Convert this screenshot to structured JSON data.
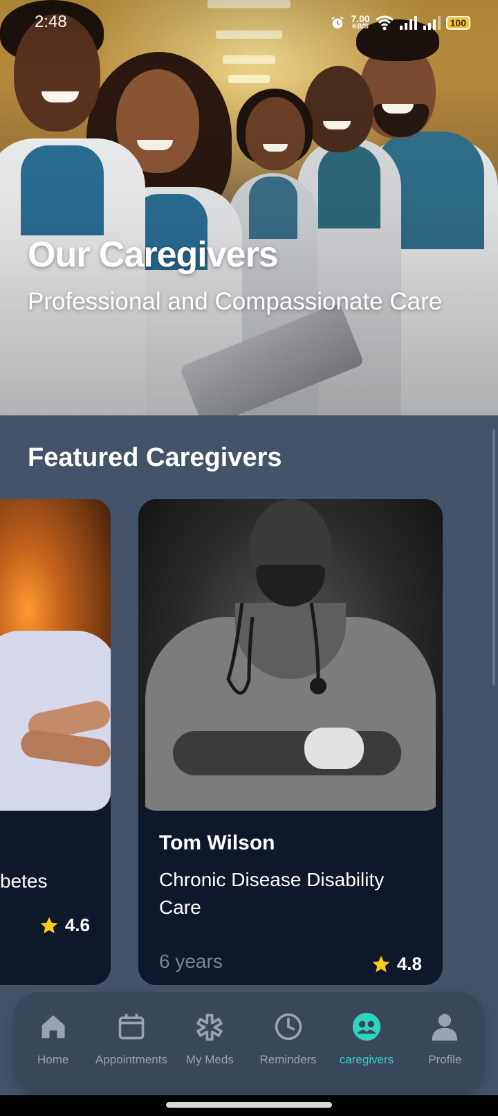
{
  "status_bar": {
    "time": "2:48",
    "net_speed": "7.00",
    "net_unit": "KB/S",
    "battery": "100"
  },
  "hero": {
    "title": "Our Caregivers",
    "subtitle": "Professional and Compassionate Care"
  },
  "featured": {
    "title": "Featured Caregivers",
    "cards": [
      {
        "name": "",
        "specialty": "betes",
        "experience": "",
        "rating": "4.6"
      },
      {
        "name": "Tom Wilson",
        "specialty": "Chronic Disease Disability Care",
        "experience": "6 years",
        "rating": "4.8"
      }
    ]
  },
  "nav": {
    "items": [
      {
        "label": "Home",
        "icon": "home-icon"
      },
      {
        "label": "Appointments",
        "icon": "calendar-icon"
      },
      {
        "label": "My Meds",
        "icon": "medical-asterisk-icon"
      },
      {
        "label": "Reminders",
        "icon": "clock-icon"
      },
      {
        "label": "caregivers",
        "icon": "caregivers-icon",
        "active": true
      },
      {
        "label": "Profile",
        "icon": "person-icon"
      }
    ]
  },
  "colors": {
    "background": "#45536a",
    "card": "#0f172a",
    "accent": "#2dd4bf",
    "nav_inactive": "#9aa3b3",
    "star": "#facc15"
  }
}
